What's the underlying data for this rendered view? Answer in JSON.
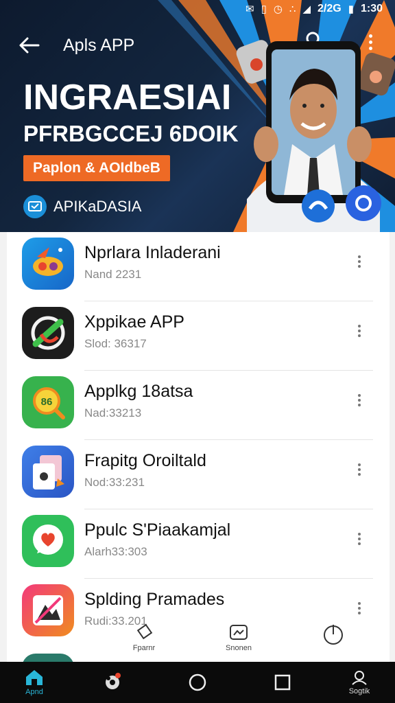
{
  "status_bar": {
    "left_text": "2/2G",
    "time": "1:30"
  },
  "header": {
    "title": "Apls APP"
  },
  "hero": {
    "headline": "INGRAESIAI",
    "subheadline": "PFRBGCCEJ 6DOIK",
    "cta_label": "Paplon & AOIdbeB",
    "brand_name": "APIKaDASIA"
  },
  "apps": [
    {
      "title": "Nprlara Inladerani",
      "subtitle": "Nand 2231",
      "icon": "rocket-app-icon"
    },
    {
      "title": "Xppikae APP",
      "subtitle": "Slod: 36317",
      "icon": "swirl-app-icon"
    },
    {
      "title": "Applkg 18atsa",
      "subtitle": "Nad:33213",
      "icon": "magnifier-app-icon"
    },
    {
      "title": "Frapitg Oroiltald",
      "subtitle": "Nod:33:231",
      "icon": "cards-app-icon"
    },
    {
      "title": "Ppulc S'Piaakamjal",
      "subtitle": "Alarh33:303",
      "icon": "chat-heart-app-icon"
    },
    {
      "title": "Splding Pramades",
      "subtitle": "Rudi:33.201",
      "icon": "gallery-app-icon"
    }
  ],
  "quick_actions": [
    {
      "label": "Fparnr",
      "icon": "tag-icon"
    },
    {
      "label": "Snonen",
      "icon": "photo-icon"
    },
    {
      "label": "",
      "icon": "power-icon"
    }
  ],
  "bottom_nav": [
    {
      "label": "Apnd",
      "icon": "home-icon",
      "active": true
    },
    {
      "label": "",
      "icon": "apps-icon",
      "active": false
    },
    {
      "label": "",
      "icon": "circle-home-icon",
      "active": false
    },
    {
      "label": "",
      "icon": "square-recents-icon",
      "active": false
    },
    {
      "label": "Sogtik",
      "icon": "account-search-icon",
      "active": false
    }
  ],
  "colors": {
    "accent": "#ee6a25",
    "brand_blue": "#1b8fd8",
    "nav_active": "#29b6d8",
    "hero_bg": "#0d1a2e"
  }
}
